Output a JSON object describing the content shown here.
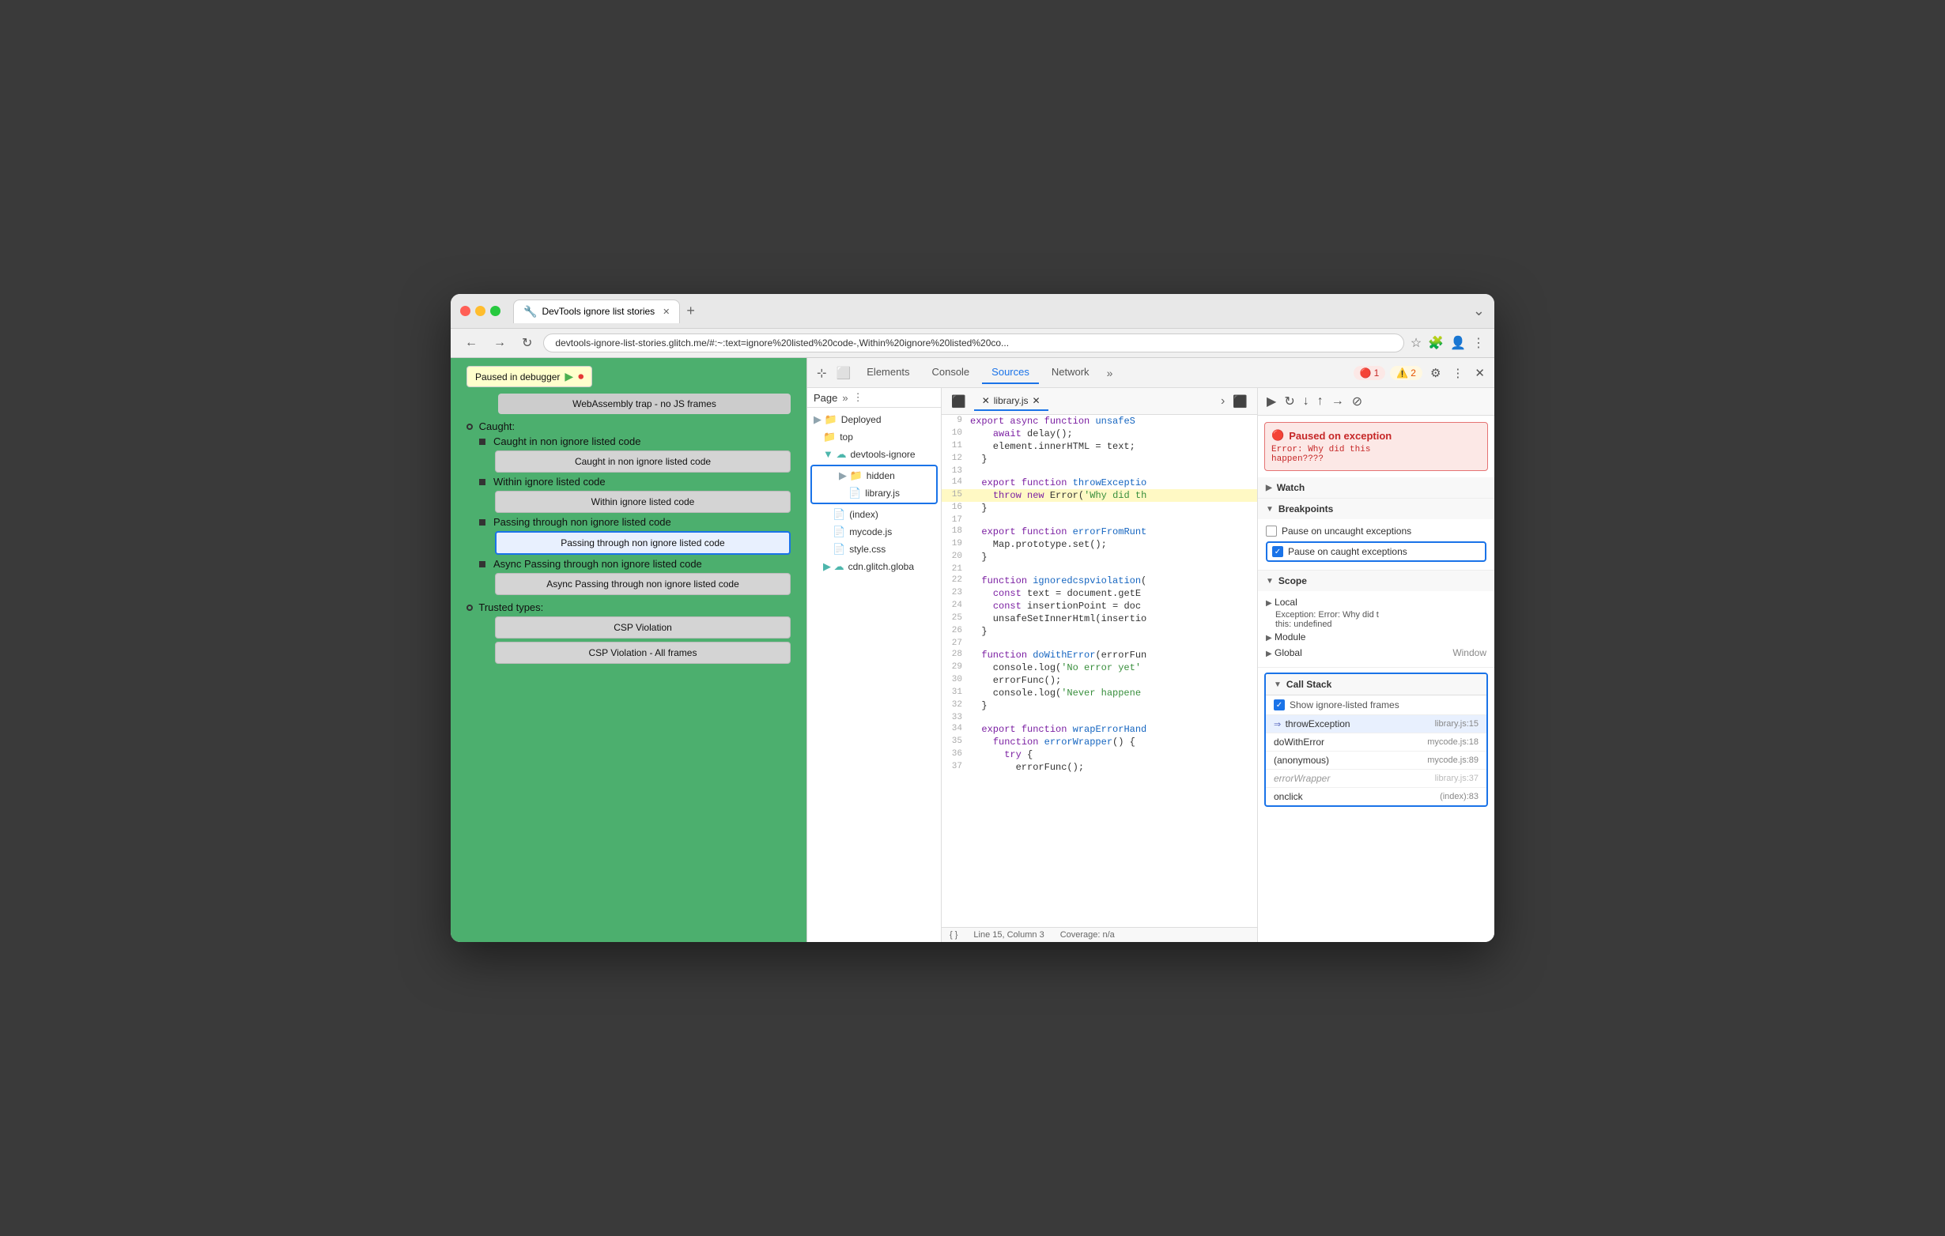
{
  "browser": {
    "tab_title": "DevTools ignore list stories",
    "tab_icon": "🔧",
    "address": "devtools-ignore-list-stories.glitch.me/#:~:text=ignore%20listed%20code-,Within%20ignore%20listed%20co...",
    "nav_back": "←",
    "nav_forward": "→",
    "nav_reload": "↻"
  },
  "page": {
    "paused_label": "Paused in debugger",
    "webassembly_label": "WebAssembly trap - no JS frames",
    "caught_section": "Caught:",
    "items": [
      {
        "label": "Caught in non ignore listed code",
        "btn": "Caught in non ignore listed code",
        "highlighted": false
      },
      {
        "label": "Within ignore listed code",
        "btn": "Within ignore listed code",
        "highlighted": false
      },
      {
        "label": "Passing through non ignore listed code",
        "btn": "Passing through non ignore listed code",
        "highlighted": true
      },
      {
        "label": "Async Passing through non ignore listed code",
        "btn": "Async Passing through non ignore listed code",
        "highlighted": false
      }
    ],
    "trusted_label": "Trusted types:",
    "trusted_items": [
      {
        "btn": "CSP Violation"
      },
      {
        "btn": "CSP Violation - All frames"
      }
    ]
  },
  "devtools": {
    "tabs": [
      "Elements",
      "Console",
      "Sources",
      "Network",
      ">>"
    ],
    "active_tab": "Sources",
    "error_count": "1",
    "warn_count": "2",
    "file_tab": "library.js"
  },
  "sources_sidebar": {
    "title": "Page",
    "tree": [
      {
        "label": "Deployed",
        "type": "folder",
        "indent": 0
      },
      {
        "label": "top",
        "type": "folder",
        "indent": 1
      },
      {
        "label": "devtools-ignore",
        "type": "cloud",
        "indent": 1,
        "expanded": true
      },
      {
        "label": "hidden",
        "type": "folder",
        "indent": 2,
        "highlighted": true
      },
      {
        "label": "library.js",
        "type": "js",
        "indent": 3,
        "highlighted": true
      },
      {
        "label": "(index)",
        "type": "html",
        "indent": 2
      },
      {
        "label": "mycode.js",
        "type": "js",
        "indent": 2
      },
      {
        "label": "style.css",
        "type": "css",
        "indent": 2
      },
      {
        "label": "cdn.glitch.globa",
        "type": "cloud",
        "indent": 1
      }
    ]
  },
  "code_editor": {
    "filename": "library.js",
    "lines": [
      {
        "num": 9,
        "content": "  export async function unsafeS"
      },
      {
        "num": 10,
        "content": "    await delay();"
      },
      {
        "num": 11,
        "content": "    element.innerHTML = text;"
      },
      {
        "num": 12,
        "content": "  }"
      },
      {
        "num": 13,
        "content": ""
      },
      {
        "num": 14,
        "content": "  export function throwExceptio"
      },
      {
        "num": 15,
        "content": "    throw new Error('Why did th",
        "highlighted": true
      },
      {
        "num": 16,
        "content": "  }"
      },
      {
        "num": 17,
        "content": ""
      },
      {
        "num": 18,
        "content": "  export function errorFromRunt"
      },
      {
        "num": 19,
        "content": "    Map.prototype.set();"
      },
      {
        "num": 20,
        "content": "  }"
      },
      {
        "num": 21,
        "content": ""
      },
      {
        "num": 22,
        "content": "  function ignoredcspviolation("
      },
      {
        "num": 23,
        "content": "    const text = document.getE"
      },
      {
        "num": 24,
        "content": "    const insertionPoint = doc"
      },
      {
        "num": 25,
        "content": "    unsafeSetInnerHtml(insertio"
      },
      {
        "num": 26,
        "content": "  }"
      },
      {
        "num": 27,
        "content": ""
      },
      {
        "num": 28,
        "content": "  function doWithError(errorFun"
      },
      {
        "num": 29,
        "content": "    console.log('No error yet'"
      },
      {
        "num": 30,
        "content": "    errorFunc();"
      },
      {
        "num": 31,
        "content": "    console.log('Never happene"
      },
      {
        "num": 32,
        "content": "  }"
      },
      {
        "num": 33,
        "content": ""
      },
      {
        "num": 34,
        "content": "  export function wrapErrorHand"
      },
      {
        "num": 35,
        "content": "    function errorWrapper() {"
      },
      {
        "num": 36,
        "content": "      try {"
      },
      {
        "num": 37,
        "content": "        errorFunc();"
      }
    ],
    "statusbar_line": "Line 15, Column 3",
    "statusbar_coverage": "Coverage: n/a"
  },
  "right_panel": {
    "exception": {
      "title": "Paused on exception",
      "message": "Error: Why did this\nhappen????"
    },
    "watch_label": "Watch",
    "breakpoints_label": "Breakpoints",
    "pause_uncaught": "Pause on uncaught exceptions",
    "pause_caught": "Pause on caught exceptions",
    "pause_caught_checked": true,
    "scope_label": "Scope",
    "local_label": "Local",
    "exception_scope": "Exception: Error: Why did t",
    "this_scope": "this: undefined",
    "module_label": "Module",
    "global_label": "Global",
    "global_value": "Window",
    "call_stack_label": "Call Stack",
    "show_ignored_label": "Show ignore-listed frames",
    "show_ignored_checked": true,
    "call_stack_frames": [
      {
        "name": "throwException",
        "loc": "library.js:15",
        "active": true,
        "dimmed": false,
        "arrow": true
      },
      {
        "name": "doWithError",
        "loc": "mycode.js:18",
        "active": false,
        "dimmed": false,
        "arrow": false
      },
      {
        "name": "(anonymous)",
        "loc": "mycode.js:89",
        "active": false,
        "dimmed": false,
        "arrow": false
      },
      {
        "name": "errorWrapper",
        "loc": "library.js:37",
        "active": false,
        "dimmed": true,
        "arrow": false
      },
      {
        "name": "onclick",
        "loc": "(index):83",
        "active": false,
        "dimmed": false,
        "arrow": false
      }
    ]
  }
}
